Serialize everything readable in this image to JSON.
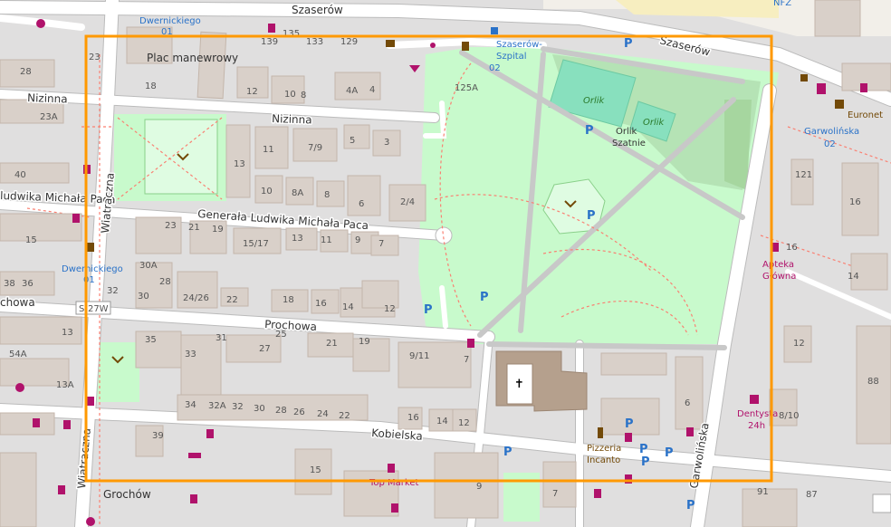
{
  "streets": {
    "szaserow_top": "Szaserów",
    "szaserow_right": "Szaserów",
    "nizinna_left": "Nizinna",
    "nizinna_mid": "Nizinna",
    "paca_left": "ludwika Michała Paca",
    "paca_main": "Generała Ludwika Michała Paca",
    "prochowa_left": "chowa",
    "prochowa_main": "Prochowa",
    "kobielska": "Kobielska",
    "wiatraczna": "Wiatraczna",
    "wiatraczna_bottom": "Wiatraczna",
    "garwolinska": "Garwolińska",
    "route_ref": "S-27W"
  },
  "places": {
    "plac": "Plac manewrowy",
    "grochow": "Grochów",
    "orlik": "Orlik",
    "orlik2": "Orlik",
    "orlik_szatnie_1": "Orlik",
    "orlik_szatnie_2": "Szatnie",
    "nfz": "NFZ"
  },
  "pois": {
    "dwernickiego_top": "Dwernickiego",
    "dwernickiego_top_ref": "01",
    "dwernickiego_left": "Dwernickiego",
    "dwernickiego_left_ref": "01",
    "szaserow_szpital_1": "Szaserów-",
    "szaserow_szpital_2": "Szpital",
    "szaserow_szpital_3": "02",
    "garwolinska_stop": "Garwolińska",
    "garwolinska_stop_ref": "02",
    "apteka_1": "Apteka",
    "apteka_2": "Główna",
    "dentysta_1": "Dentysta",
    "dentysta_2": "24h",
    "pizzeria_1": "Pizzeria",
    "pizzeria_2": "Incanto",
    "top_market": "Top Market",
    "euronet": "Euronet",
    "parking": "P"
  },
  "house_numbers": [
    "139",
    "135",
    "133",
    "129",
    "23",
    "28",
    "18",
    "12",
    "10",
    "8",
    "4A",
    "4",
    "125A",
    "23A",
    "11",
    "7/9",
    "5",
    "3",
    "13",
    "10",
    "8A",
    "8",
    "6",
    "2/4",
    "40",
    "15",
    "23",
    "21",
    "19",
    "15/17",
    "13",
    "11",
    "9",
    "7",
    "30A",
    "28",
    "32",
    "30",
    "24/26",
    "22",
    "18",
    "16",
    "14",
    "12",
    "38",
    "36",
    "13",
    "35",
    "31",
    "33",
    "27",
    "25",
    "21",
    "19",
    "9/11",
    "7",
    "54A",
    "13A",
    "34",
    "32A",
    "32",
    "30",
    "28",
    "26",
    "24",
    "22",
    "16",
    "14",
    "12",
    "39",
    "15",
    "9",
    "7",
    "6",
    "16",
    "121",
    "16",
    "14",
    "12",
    "88",
    "8/10",
    "91",
    "87"
  ],
  "colors": {
    "highlight_box": "#ff9900",
    "park": "#c8facc",
    "pitch": "#88e0be",
    "church": "#b5a08d",
    "footway": "#fa8072",
    "poi_blue": "#2a72c8",
    "poi_magenta": "#b0126b"
  }
}
